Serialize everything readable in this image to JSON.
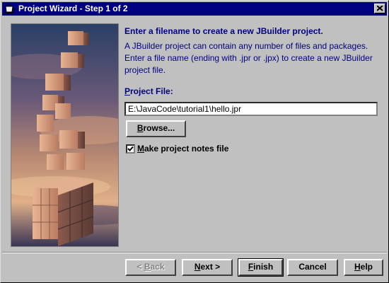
{
  "window": {
    "title": "Project Wizard - Step 1 of 2"
  },
  "icons": {
    "app": "cup-icon",
    "close": "close-icon",
    "check": "checkmark-icon"
  },
  "content": {
    "heading": "Enter a filename to create a new JBuilder project.",
    "description_lines": [
      "A JBuilder project can contain any number of files and packages.",
      "Enter a file name (ending with .jpr or .jpx) to create a new JBuilder",
      "project file."
    ],
    "project_file_label": {
      "mnemonic": "P",
      "rest": "roject File:"
    },
    "project_file_value": "E:\\JavaCode\\tutorial1\\hello.jpr",
    "browse_label": {
      "mnemonic": "B",
      "rest": "rowse..."
    },
    "notes_checkbox": {
      "checked": true,
      "mnemonic": "M",
      "rest": "ake project notes file"
    }
  },
  "buttons": {
    "back": {
      "prefix": "< ",
      "mnemonic": "B",
      "rest": "ack",
      "enabled": false
    },
    "next": {
      "mnemonic": "N",
      "rest": "ext >",
      "enabled": true
    },
    "finish": {
      "mnemonic": "F",
      "rest": "inish",
      "enabled": true,
      "default": true
    },
    "cancel": {
      "label": "Cancel",
      "enabled": true
    },
    "help": {
      "mnemonic": "H",
      "rest": "elp",
      "enabled": true
    }
  },
  "colors": {
    "title_bar": "#000080",
    "text_accent": "#000080",
    "face": "#c0c0c0"
  }
}
